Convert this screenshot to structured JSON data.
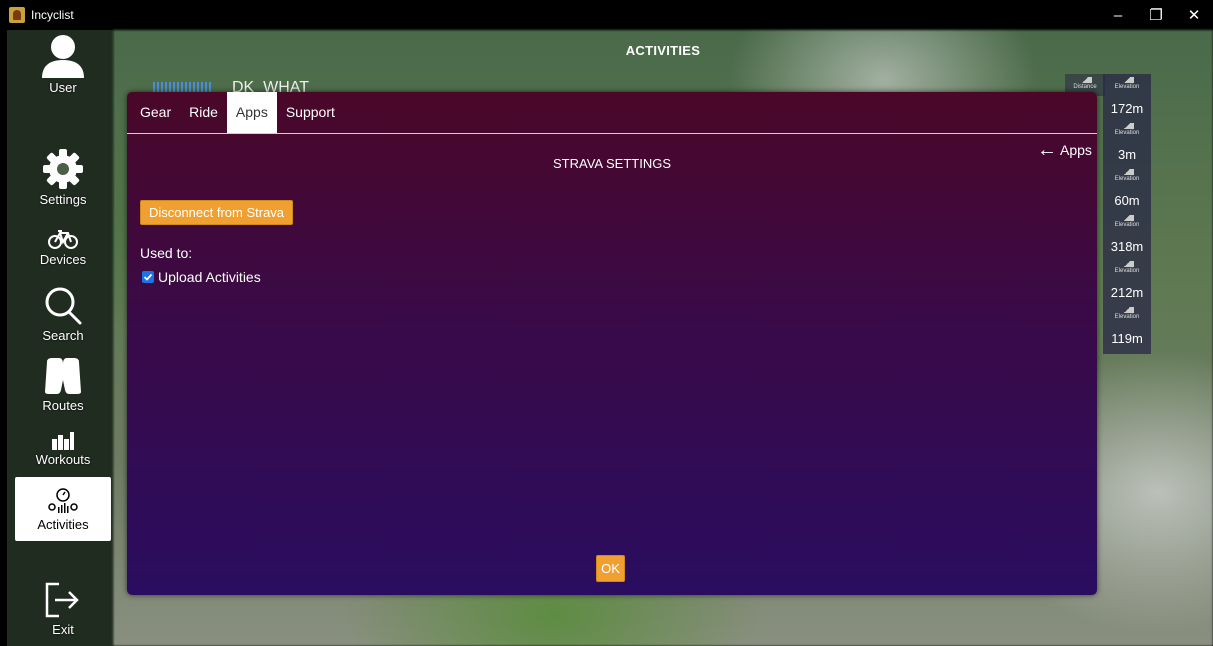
{
  "window": {
    "title": "Incyclist",
    "controls": [
      "–",
      "❐",
      "✕"
    ]
  },
  "sidebar": {
    "items": [
      {
        "label": "User",
        "icon": "user-icon"
      },
      {
        "label": "Settings",
        "icon": "gear-icon"
      },
      {
        "label": "Devices",
        "icon": "bike-icon"
      },
      {
        "label": "Search",
        "icon": "search-icon"
      },
      {
        "label": "Routes",
        "icon": "routes-icon"
      },
      {
        "label": "Workouts",
        "icon": "workouts-icon"
      },
      {
        "label": "Activities",
        "icon": "activities-icon",
        "active": true
      },
      {
        "label": "Exit",
        "icon": "exit-icon"
      }
    ]
  },
  "page": {
    "title": "ACTIVITIES"
  },
  "background_list": {
    "first_row_name": "DK_WHAT",
    "stat_caption_distance": "Distance",
    "stat_caption_elevation": "Elevation",
    "elevations": [
      "172m",
      "3m",
      "60m",
      "318m",
      "212m",
      "119m"
    ]
  },
  "dialog": {
    "tabs": [
      {
        "label": "Gear",
        "active": false
      },
      {
        "label": "Ride",
        "active": false
      },
      {
        "label": "Apps",
        "active": true
      },
      {
        "label": "Support",
        "active": false
      }
    ],
    "heading": "STRAVA SETTINGS",
    "back_label": "Apps",
    "disconnect_label": "Disconnect from Strava",
    "used_to_label": "Used to:",
    "upload_label": "Upload Activities",
    "upload_checked": true,
    "ok_label": "OK"
  },
  "colors": {
    "accent_orange": "#f0a030",
    "checkbox_blue": "#1a73e8",
    "dialog_top": "#4a0728",
    "dialog_bottom": "#2a0d60"
  }
}
